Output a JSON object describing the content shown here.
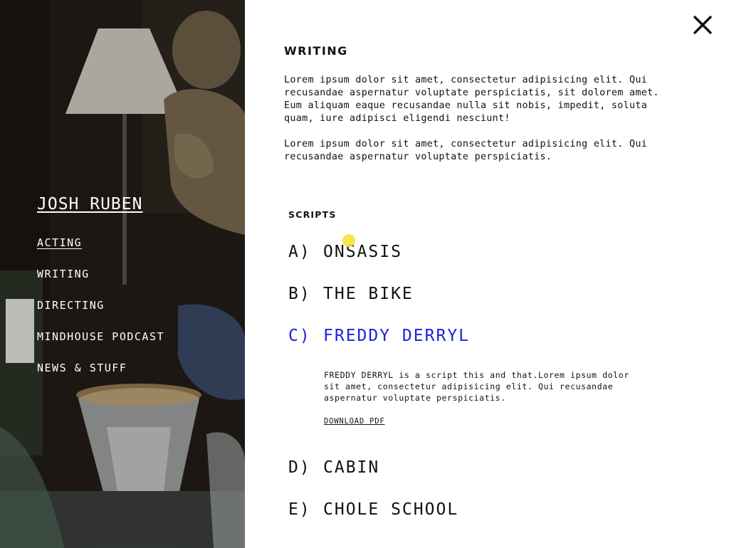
{
  "sidebar": {
    "site_title": "JOSH RUBEN",
    "nav": [
      {
        "label": "ACTING",
        "active": true
      },
      {
        "label": "WRITING",
        "active": false
      },
      {
        "label": "DIRECTING",
        "active": false
      },
      {
        "label": "MINDHOUSE PODCAST",
        "active": false
      },
      {
        "label": "NEWS & STUFF",
        "active": false
      }
    ]
  },
  "panel": {
    "close_icon": "close-icon",
    "title": "WRITING",
    "intro_paragraphs": [
      "Lorem ipsum dolor sit amet, consectetur adipisicing elit. Qui recusandae aspernatur voluptate perspiciatis, sit dolorem amet. Eum aliquam eaque recusandae nulla sit nobis, impedit, soluta quam, iure adipisci eligendi nesciunt!",
      "Lorem ipsum dolor sit amet, consectetur adipisicing elit. Qui recusandae aspernatur voluptate perspiciatis."
    ],
    "scripts_heading": "SCRIPTS",
    "scripts": [
      {
        "letter": "A)",
        "title": "ONSASIS"
      },
      {
        "letter": "B)",
        "title": "THE BIKE"
      },
      {
        "letter": "C)",
        "title": "FREDDY DERRYL",
        "expanded": true,
        "description": "FREDDY DERRYL is a script this and that.Lorem ipsum dolor sit amet, consectetur adipisicing elit. Qui recusandae aspernatur voluptate perspiciatis.",
        "download_label": "DOWNLOAD PDF"
      },
      {
        "letter": "D)",
        "title": "CABIN"
      },
      {
        "letter": "E)",
        "title": "CHOLE SCHOOL"
      }
    ]
  },
  "colors": {
    "active_link": "#1a22e0",
    "cursor_highlight": "#f7e23a",
    "text": "#111111",
    "background": "#ffffff"
  }
}
